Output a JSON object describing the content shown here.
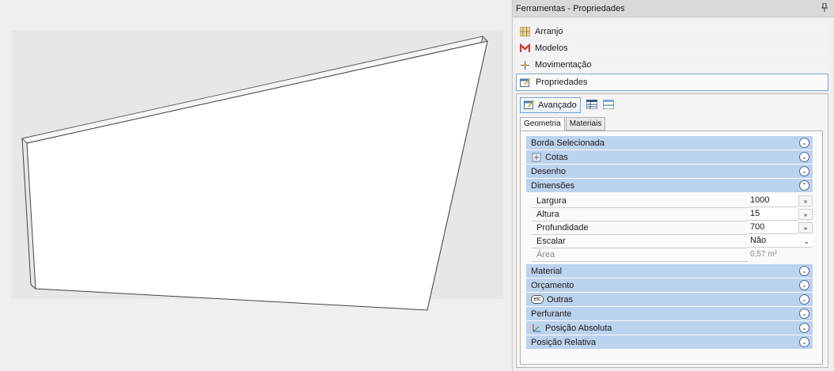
{
  "panel": {
    "title": "Ferramentas - Propriedades",
    "pin_glyph": "⫯"
  },
  "nav": {
    "items": [
      {
        "label": "Arranjo",
        "icon": "grid-icon"
      },
      {
        "label": "Modelos",
        "icon": "models-icon"
      },
      {
        "label": "Movimentação",
        "icon": "move-icon"
      },
      {
        "label": "Propriedades",
        "icon": "properties-icon",
        "active": true
      }
    ]
  },
  "subpanel": {
    "advanced_label": "Avançado",
    "tabs": [
      "Geometria",
      "Materiais"
    ]
  },
  "groups": {
    "borda": "Borda Selecionada",
    "cotas": "Cotas",
    "desenho": "Desenho",
    "dimensoes": "Dimensões",
    "material": "Material",
    "orcamento": "Orçamento",
    "outras": "Outras",
    "perfurante": "Perfurante",
    "pos_abs": "Posição Absoluta",
    "pos_rel": "Posição Relativa"
  },
  "dimensions": {
    "largura": {
      "label": "Largura",
      "value": "1000"
    },
    "altura": {
      "label": "Altura",
      "value": "15"
    },
    "profundidade": {
      "label": "Profundidade",
      "value": "700"
    },
    "escalar": {
      "label": "Escalar",
      "value": "Não"
    },
    "area": {
      "label": "Área",
      "value": "0,57 m²"
    }
  },
  "glyphs": {
    "expand": "»",
    "chev_down": "⌄",
    "collapse": "⌃",
    "combo_arrow": "⌄",
    "etc": "etc"
  },
  "colors": {
    "accent": "#7fa7d6",
    "group_bg": "#bcd3ee"
  }
}
